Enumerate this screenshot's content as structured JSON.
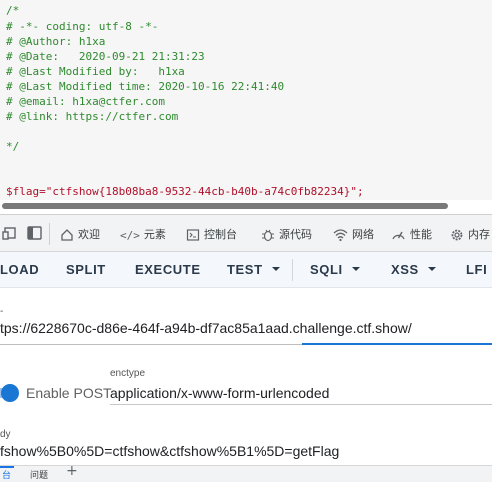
{
  "source": {
    "lines": [
      "/*",
      "# -*- coding: utf-8 -*-",
      "# @Author: h1xa",
      "# @Date:   2020-09-21 21:31:23",
      "# @Last Modified by:   h1xa",
      "# @Last Modified time: 2020-10-16 22:41:40",
      "# @email: h1xa@ctfer.com",
      "# @link: https://ctfer.com",
      "",
      "*/"
    ],
    "flag_line": "$flag=\"ctfshow{18b08ba8-9532-44cb-b40b-a74c0fb82234}\";"
  },
  "devtools": {
    "tabs": {
      "welcome": "欢迎",
      "elements": "元素",
      "console": "控制台",
      "sources": "源代码",
      "network": "网络",
      "performance": "性能",
      "memory": "内存"
    }
  },
  "hackbar": {
    "load": "LOAD",
    "split": "SPLIT",
    "execute": "EXECUTE",
    "test": "TEST",
    "sqli": "SQLI",
    "xss": "XSS",
    "lfi": "LFI"
  },
  "form": {
    "url_label": "-",
    "url_value": "tps://6228670c-d86e-464f-a94b-df7ac85a1aad.challenge.ctf.show/",
    "enable_post_label": "Enable POST",
    "enctype_label": "enctype",
    "enctype_value": "application/x-www-form-urlencoded",
    "body_label": "dy",
    "body_value": "fshow%5B0%5D=ctfshow&ctfshow%5B1%5D=getFlag"
  },
  "drawer": {
    "active_tab": "台",
    "issues_tab": "问题",
    "add_tab": "+"
  },
  "colors": {
    "comment": "#2f8a2f",
    "flag": "#b0102a",
    "accent": "#1976d2"
  }
}
